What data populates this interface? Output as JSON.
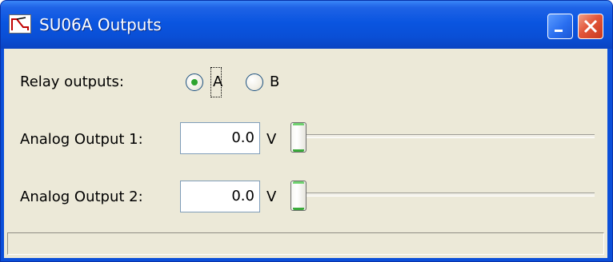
{
  "window": {
    "title": "SU06A Outputs",
    "icon": "relay-app-icon"
  },
  "relay": {
    "label": "Relay outputs:",
    "options": [
      "A",
      "B"
    ],
    "selected": "A"
  },
  "analog": [
    {
      "label": "Analog Output 1:",
      "value": "0.0",
      "unit": "V",
      "slider_level": 0
    },
    {
      "label": "Analog Output 2:",
      "value": "0.0",
      "unit": "V",
      "slider_level": 0
    }
  ],
  "status": {
    "text": ""
  },
  "colors": {
    "titlebar": "#0a55e0",
    "client_bg": "#ece9d8",
    "radio_selected": "#2ea32e",
    "close_button": "#e2563a"
  }
}
